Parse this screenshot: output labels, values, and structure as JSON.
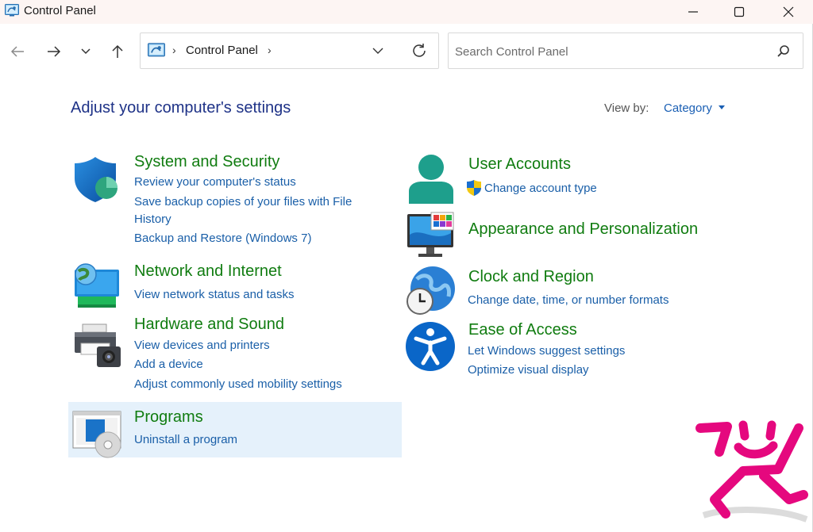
{
  "window": {
    "title": "Control Panel",
    "controls": {
      "minimize": "minimize",
      "maximize": "maximize",
      "close": "close"
    }
  },
  "nav": {
    "address": {
      "crumb": "Control Panel",
      "separator": "›"
    },
    "search": {
      "placeholder": "Search Control Panel"
    }
  },
  "main": {
    "heading": "Adjust your computer's settings",
    "view_by": {
      "label": "View by:",
      "value": "Category"
    }
  },
  "categories": {
    "system_security": {
      "title": "System and Security",
      "links": [
        "Review your computer's status",
        "Save backup copies of your files with File",
        "History",
        "Backup and Restore (Windows 7)"
      ]
    },
    "network": {
      "title": "Network and Internet",
      "links": [
        "View network status and tasks"
      ]
    },
    "hardware": {
      "title": "Hardware and Sound",
      "links": [
        "View devices and printers",
        "Add a device",
        "Adjust commonly used mobility settings"
      ]
    },
    "programs": {
      "title": "Programs",
      "links": [
        "Uninstall a program"
      ]
    },
    "user_accounts": {
      "title": "User Accounts",
      "links": [
        "Change account type"
      ]
    },
    "appearance": {
      "title": "Appearance and Personalization",
      "links": []
    },
    "clock": {
      "title": "Clock and Region",
      "links": [
        "Change date, time, or number formats"
      ]
    },
    "ease": {
      "title": "Ease of Access",
      "links": [
        "Let Windows suggest settings",
        "Optimize visual display"
      ]
    }
  },
  "colors": {
    "category_title": "#107c10",
    "link": "#1a5fa8",
    "heading": "#1e3287",
    "selection": "#e5f1fb",
    "logo": "#e5087e"
  },
  "icons": {
    "back": "back-arrow-icon",
    "forward": "forward-arrow-icon",
    "recent": "chevron-down-icon",
    "up": "up-arrow-icon",
    "refresh": "refresh-icon",
    "search": "search-icon"
  }
}
